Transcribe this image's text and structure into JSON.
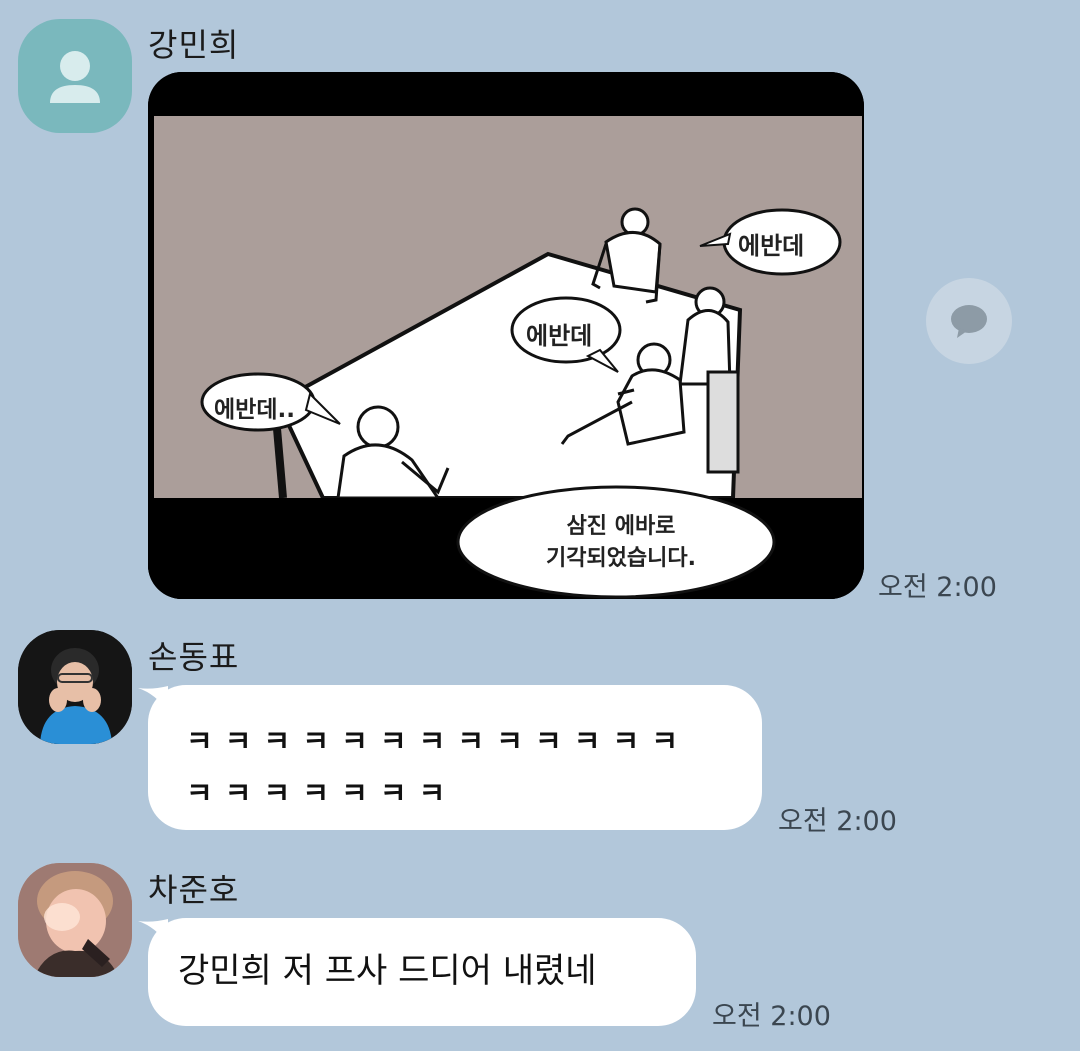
{
  "messages": [
    {
      "sender": "강민희",
      "time": "오전 2:00",
      "image": {
        "bubbles": [
          "에반데",
          "에반데",
          "에반데..",
          "삼진 에바로",
          "기각되었습니다."
        ]
      }
    },
    {
      "sender": "손동표",
      "time": "오전 2:00",
      "lines": [
        "ㅋ ㅋ ㅋ ㅋ ㅋ ㅋ ㅋ ㅋ ㅋ ㅋ ㅋ ㅋ ㅋ",
        "ㅋ ㅋ ㅋ ㅋ ㅋ ㅋ ㅋ"
      ]
    },
    {
      "sender": "차준호",
      "time": "오전 2:00",
      "text": "강민희 저 프사 드디어 내렸네"
    }
  ],
  "icons": {
    "default_avatar": "person-icon",
    "share": "speech-bubble-icon"
  },
  "colors": {
    "background": "#b2c7da",
    "default_avatar": "#7ab8bd",
    "bubble": "#ffffff"
  }
}
